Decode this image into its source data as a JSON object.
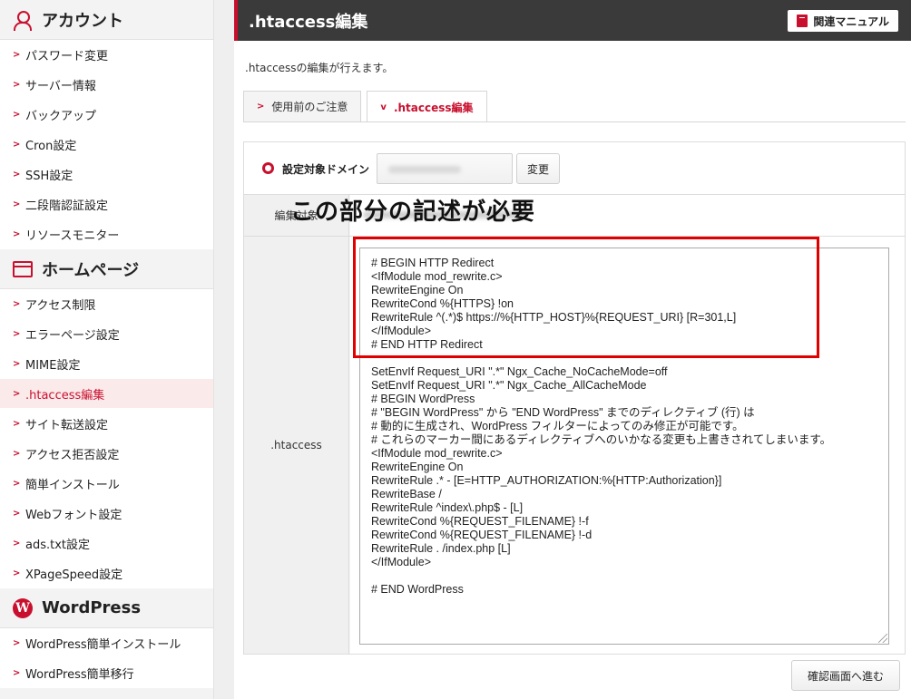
{
  "sidebar": {
    "account": {
      "title": "アカウント",
      "items": [
        "パスワード変更",
        "サーバー情報",
        "バックアップ",
        "Cron設定",
        "SSH設定",
        "二段階認証設定",
        "リソースモニター"
      ]
    },
    "homepage": {
      "title": "ホームページ",
      "items": [
        "アクセス制限",
        "エラーページ設定",
        "MIME設定",
        ".htaccess編集",
        "サイト転送設定",
        "アクセス拒否設定",
        "簡単インストール",
        "Webフォント設定",
        "ads.txt設定",
        "XPageSpeed設定"
      ],
      "active": ".htaccess編集"
    },
    "wordpress": {
      "title": "WordPress",
      "items": [
        "WordPress簡単インストール",
        "WordPress簡単移行"
      ]
    }
  },
  "header": {
    "title": ".htaccess編集",
    "manual_button": "関連マニュアル"
  },
  "description": ".htaccessの編集が行えます。",
  "tabs": [
    {
      "label": "使用前のご注意",
      "active": false
    },
    {
      "label": ".htaccess編集",
      "active": true
    }
  ],
  "form": {
    "domain_label": "設定対象ドメイン",
    "change_button": "変更",
    "target_label": "編集対象",
    "htaccess_label": ".htaccess",
    "htaccess_content": "# BEGIN HTTP Redirect\n<IfModule mod_rewrite.c>\nRewriteEngine On\nRewriteCond %{HTTPS} !on\nRewriteRule ^(.*)$ https://%{HTTP_HOST}%{REQUEST_URI} [R=301,L]\n</IfModule>\n# END HTTP Redirect\n\nSetEnvIf Request_URI \".*\" Ngx_Cache_NoCacheMode=off\nSetEnvIf Request_URI \".*\" Ngx_Cache_AllCacheMode\n# BEGIN WordPress\n# \"BEGIN WordPress\" から \"END WordPress\" までのディレクティブ (行) は\n# 動的に生成され、WordPress フィルターによってのみ修正が可能です。\n# これらのマーカー間にあるディレクティブへのいかなる変更も上書きされてしまいます。\n<IfModule mod_rewrite.c>\nRewriteEngine On\nRewriteRule .* - [E=HTTP_AUTHORIZATION:%{HTTP:Authorization}]\nRewriteBase /\nRewriteRule ^index\\.php$ - [L]\nRewriteCond %{REQUEST_FILENAME} !-f\nRewriteCond %{REQUEST_FILENAME} !-d\nRewriteRule . /index.php [L]\n</IfModule>\n\n# END WordPress",
    "confirm_button": "確認画面へ進む"
  },
  "annotation": {
    "callout": "この部分の記述が必要",
    "highlight_color": "#e00000"
  },
  "colors": {
    "accent": "#c8102e",
    "header_bg": "#3a3a3a"
  }
}
